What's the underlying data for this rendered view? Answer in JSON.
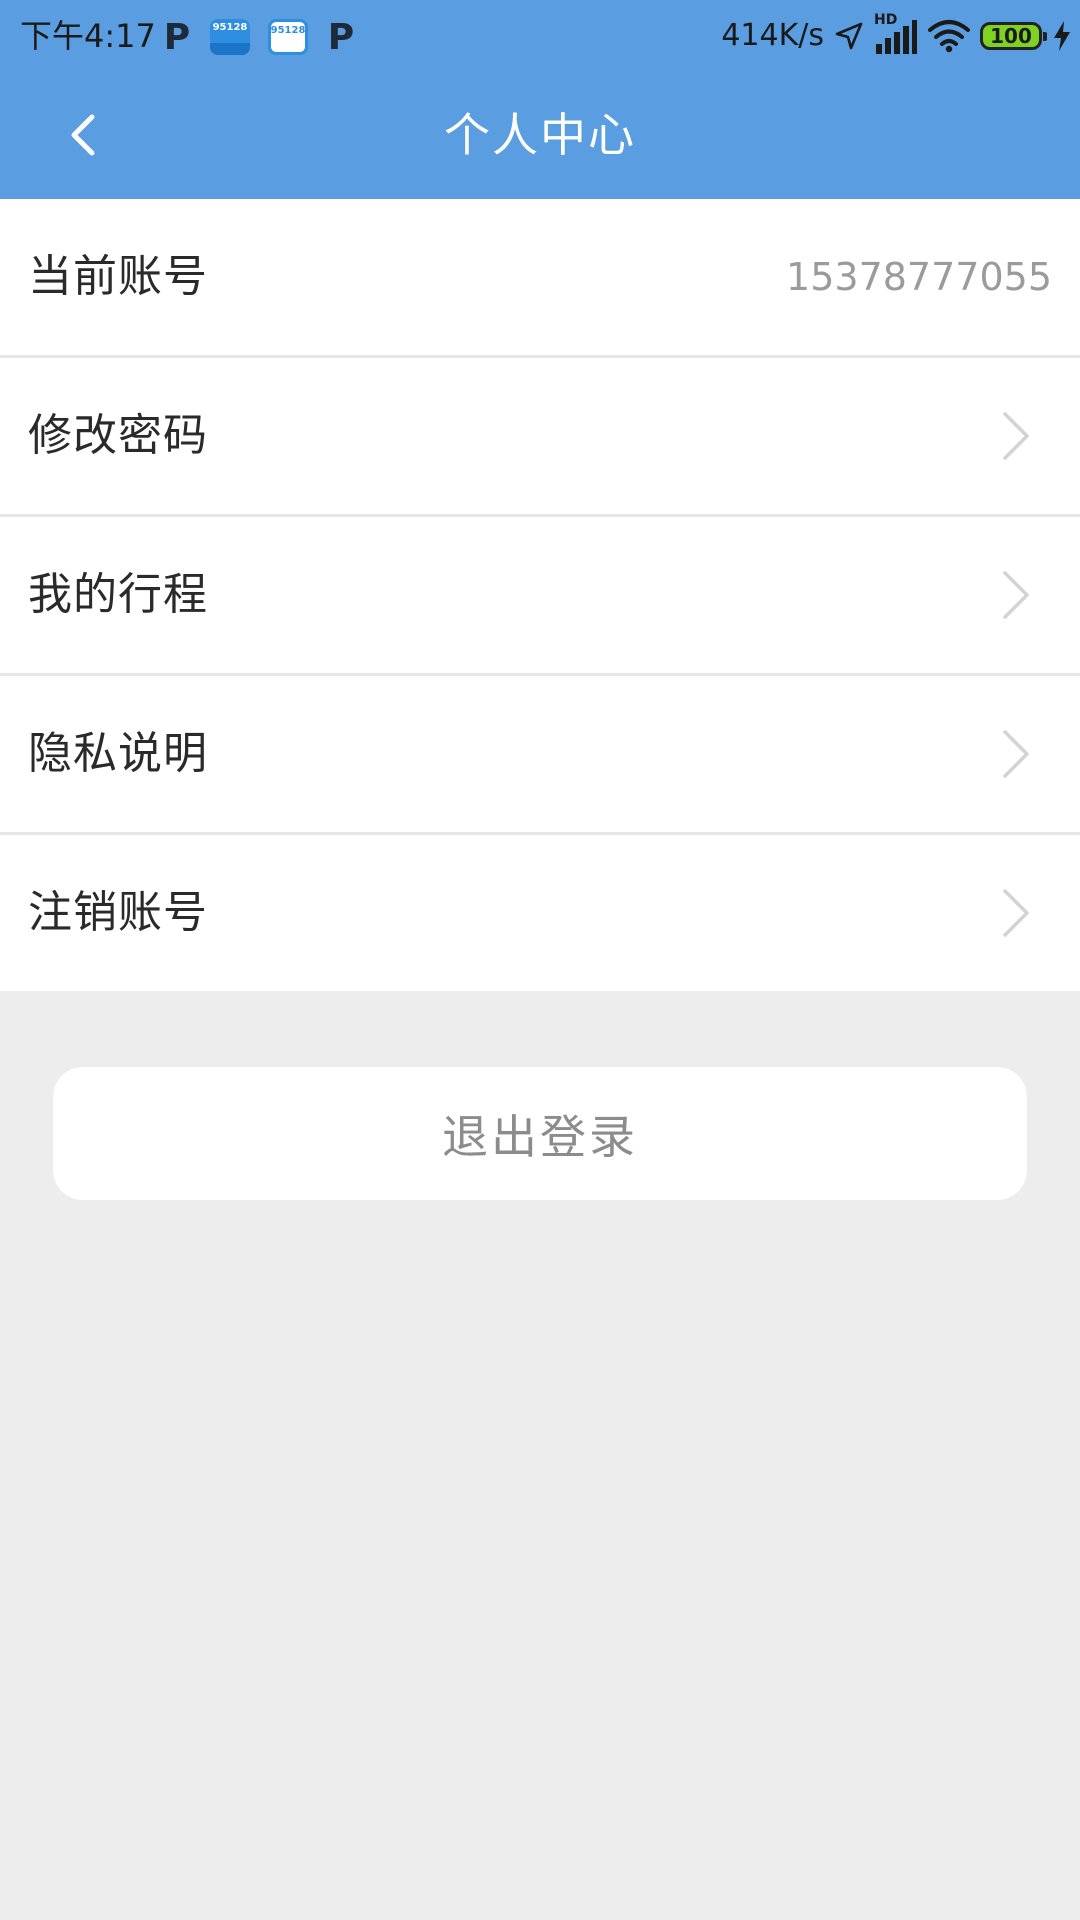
{
  "status_bar": {
    "time": "下午4:17",
    "left_icons": [
      "p-app-icon",
      "95128-app-icon",
      "95128-app-icon-alt",
      "p-app-icon"
    ],
    "app_badge_text": "95128",
    "p_letter": "P",
    "net_speed": "414K/s",
    "hd_label": "HD",
    "battery_level": "100",
    "battery_color": "#7ed321"
  },
  "header": {
    "title": "个人中心",
    "background": "#5a9de0",
    "back_icon": "chevron-left-icon"
  },
  "menu": {
    "account": {
      "label": "当前账号",
      "value": "15378777055"
    },
    "items": [
      {
        "label": "修改密码",
        "icon": "chevron-right-icon"
      },
      {
        "label": "我的行程",
        "icon": "chevron-right-icon"
      },
      {
        "label": "隐私说明",
        "icon": "chevron-right-icon"
      },
      {
        "label": "注销账号",
        "icon": "chevron-right-icon"
      }
    ]
  },
  "logout": {
    "label": "退出登录"
  }
}
